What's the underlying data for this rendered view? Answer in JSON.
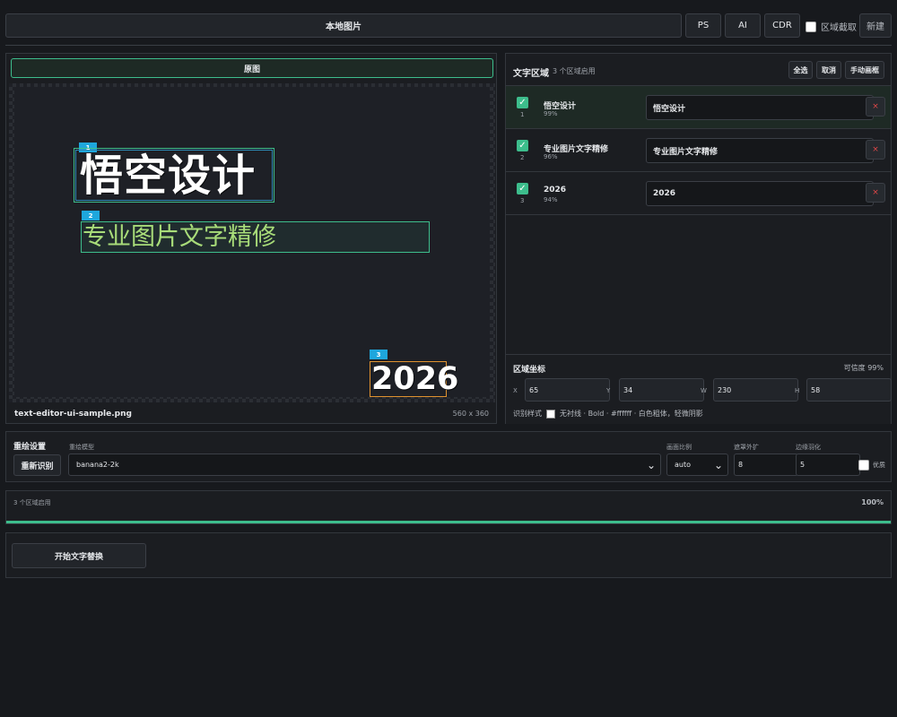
{
  "topbar": {
    "local_image": "本地图片",
    "ps": "PS",
    "ai": "AI",
    "cdr": "CDR",
    "region_crop": "区域截取",
    "new": "新建"
  },
  "left": {
    "original_button": "原图",
    "file_name": "text-editor-ui-sample.png",
    "file_size": "560 x 360",
    "regions": [
      {
        "badge": "1",
        "text": "悟空设计"
      },
      {
        "badge": "2",
        "text": "专业图片文字精修"
      },
      {
        "badge": "3",
        "text": "2026"
      }
    ]
  },
  "right": {
    "title": "文字区域",
    "count": "3 个区域启用",
    "select_all": "全选",
    "cancel": "取消",
    "manual_draw": "手动画框",
    "rows": [
      {
        "index": "1",
        "label": "悟空设计",
        "confidence": "99%",
        "value": "悟空设计",
        "delete": "×"
      },
      {
        "index": "2",
        "label": "专业图片文字精修",
        "confidence": "96%",
        "value": "专业图片文字精修",
        "delete": "×"
      },
      {
        "index": "3",
        "label": "2026",
        "confidence": "94%",
        "value": "2026",
        "delete": "×"
      }
    ],
    "coords": {
      "title": "区域坐标",
      "confidence": "可信度 99%",
      "x_label": "X",
      "x": "65",
      "y_label": "Y",
      "y": "34",
      "w_label": "W",
      "w": "230",
      "h_label": "H",
      "h": "58"
    },
    "style": {
      "label": "识别样式",
      "description": "无衬线 · Bold · #ffffff · 白色粗体，轻微阴影",
      "swatch_color": "#ffffff"
    }
  },
  "settings": {
    "title": "重绘设置",
    "reocr": "重新识别",
    "model_label": "重绘模型",
    "model_value": "banana2-2k",
    "ratio_label": "画面比例",
    "ratio_value": "auto",
    "expand_label": "遮罩外扩",
    "expand_value": "8",
    "feather_label": "边缘羽化",
    "feather_value": "5",
    "optimize_label": "优质"
  },
  "progress": {
    "label": "3 个区域启用",
    "percent_text": "100%",
    "value": 1.0
  },
  "start": {
    "button": "开始文字替换"
  }
}
